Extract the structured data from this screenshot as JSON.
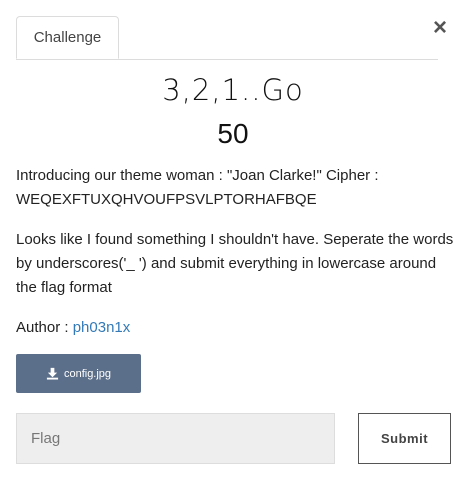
{
  "tabs": [
    {
      "label": "Challenge"
    }
  ],
  "close_glyph": "×",
  "challenge": {
    "name": "3,2,1..Go",
    "value": "50",
    "description_1": "Introducing our theme woman : \"Joan Clarke!\" Cipher : WEQEXFTUXQHVOUFPSVLPTORHAFBQE",
    "description_2": "Looks like I found something I shouldn't have. Seperate the words by underscores('_ ') and submit everything in lowercase around the flag format",
    "author_label": "Author :",
    "author_name": "ph03n1x",
    "file": {
      "name": "config.jpg",
      "icon": "download-icon"
    }
  },
  "form": {
    "placeholder": "Flag",
    "value": "",
    "submit_label": "Submit"
  },
  "colors": {
    "file_button_bg": "#5c6f8a",
    "link": "#337ab7",
    "input_bg": "#eeeeee"
  }
}
